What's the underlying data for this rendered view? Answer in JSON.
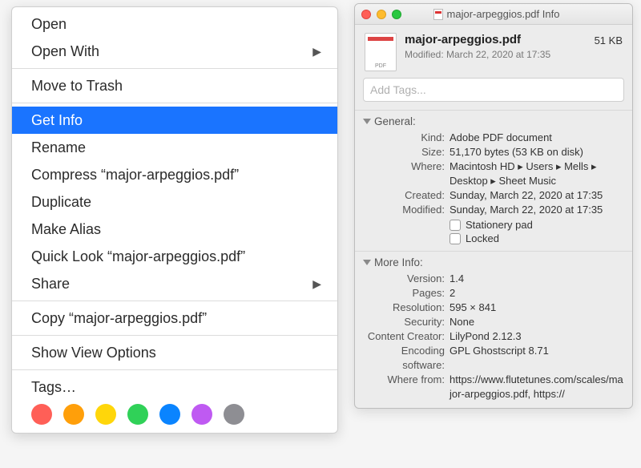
{
  "context_menu": {
    "open": "Open",
    "open_with": "Open With",
    "move_to_trash": "Move to Trash",
    "get_info": "Get Info",
    "rename": "Rename",
    "compress": "Compress “major-arpeggios.pdf”",
    "duplicate": "Duplicate",
    "make_alias": "Make Alias",
    "quick_look": "Quick Look “major-arpeggios.pdf”",
    "share": "Share",
    "copy": "Copy “major-arpeggios.pdf”",
    "show_view_options": "Show View Options",
    "tags": "Tags…",
    "tag_colors": [
      "#ff5f57",
      "#ff9f0a",
      "#ffd60a",
      "#30d158",
      "#0a84ff",
      "#bf5af2",
      "#8e8e93"
    ]
  },
  "info_window": {
    "title": "major-arpeggios.pdf Info",
    "file_name": "major-arpeggios.pdf",
    "file_size": "51 KB",
    "modified_header": "Modified: March 22, 2020 at 17:35",
    "tags_placeholder": "Add Tags...",
    "general": {
      "label": "General:",
      "kind_k": "Kind:",
      "kind_v": "Adobe PDF document",
      "size_k": "Size:",
      "size_v": "51,170 bytes (53 KB on disk)",
      "where_k": "Where:",
      "where_v": "Macintosh HD ▸ Users ▸ Mells ▸ Desktop ▸ Sheet Music",
      "created_k": "Created:",
      "created_v": "Sunday, March 22, 2020 at 17:35",
      "modified_k": "Modified:",
      "modified_v": "Sunday, March 22, 2020 at 17:35",
      "stationery": "Stationery pad",
      "locked": "Locked"
    },
    "more_info": {
      "label": "More Info:",
      "version_k": "Version:",
      "version_v": "1.4",
      "pages_k": "Pages:",
      "pages_v": "2",
      "resolution_k": "Resolution:",
      "resolution_v": "595 × 841",
      "security_k": "Security:",
      "security_v": "None",
      "creator_k": "Content Creator:",
      "creator_v": "LilyPond 2.12.3",
      "encoding_k": "Encoding software:",
      "encoding_v": "GPL Ghostscript 8.71",
      "wherefrom_k": "Where from:",
      "wherefrom_v": "https://www.flutetunes.com/scales/major-arpeggios.pdf, https://"
    }
  }
}
